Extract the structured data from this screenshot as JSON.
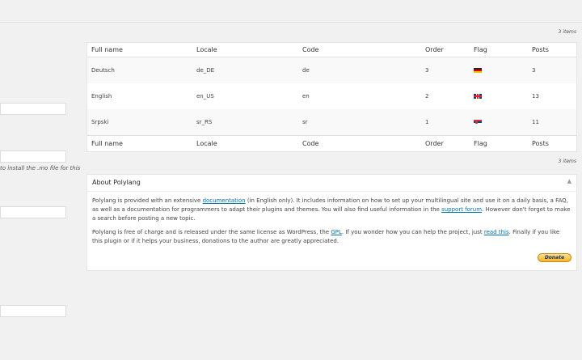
{
  "left_form": {
    "note": "to install the .mo file for this"
  },
  "languages_table": {
    "count_top": "3 items",
    "count_bottom": "3 items",
    "columns": [
      "Full name",
      "Locale",
      "Code",
      "Order",
      "Flag",
      "Posts"
    ],
    "rows": [
      {
        "full_name": "Deutsch",
        "locale": "de_DE",
        "code": "de",
        "order": "3",
        "flag": "german-flag-icon",
        "posts": "3"
      },
      {
        "full_name": "English",
        "locale": "en_US",
        "code": "en",
        "order": "2",
        "flag": "uk-flag-icon",
        "posts": "13"
      },
      {
        "full_name": "Srpski",
        "locale": "sr_RS",
        "code": "sr",
        "order": "1",
        "flag": "serbian-flag-icon",
        "posts": "11"
      }
    ]
  },
  "about": {
    "title": "About Polylang",
    "p1_a": "Polylang is provided with an extensive ",
    "p1_link1": "documentation",
    "p1_b": " (in English only). It includes information on how to set up your multilingual site and use it on a daily basis, a FAQ, as well as a documentation for programmers to adapt their plugins and themes. You will also find useful information in the ",
    "p1_link2": "support forum",
    "p1_c": ". However don't forget to make a search before posting a new topic.",
    "p2_a": "Polylang is free of charge and is released under the same license as WordPress, the ",
    "p2_link1": "GPL",
    "p2_b": ". If you wonder how you can help the project, just ",
    "p2_link2": "read this",
    "p2_c": ". Finally if you like this plugin or if it helps your business, donations to the author are greatly appreciated.",
    "donate_label": "Donate"
  }
}
